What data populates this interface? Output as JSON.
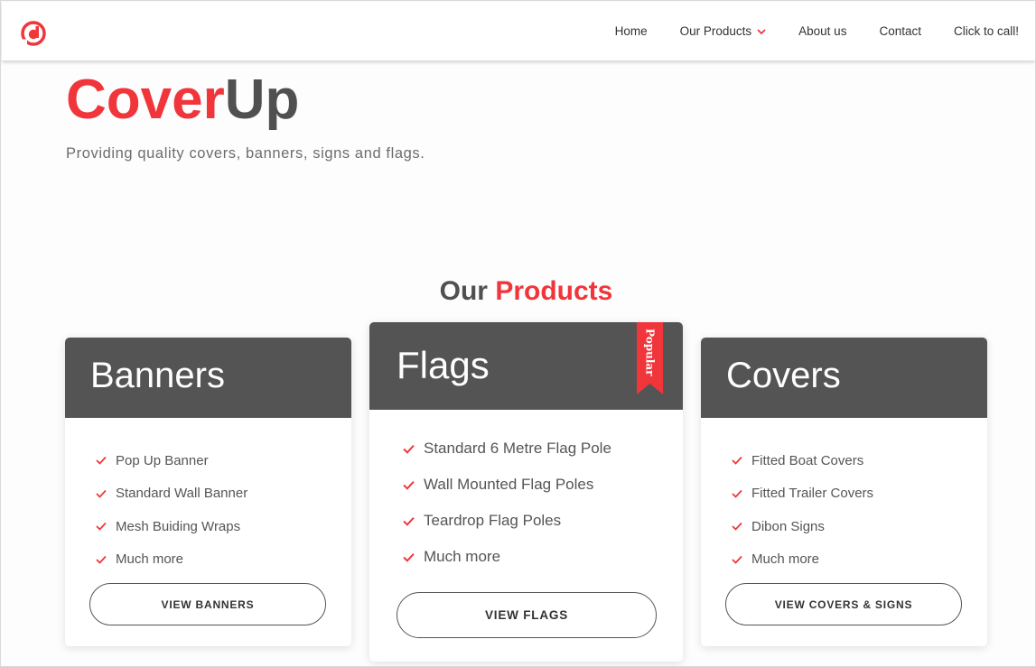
{
  "nav": {
    "links": [
      {
        "label": "Home"
      },
      {
        "label": "Our Products"
      },
      {
        "label": "About us"
      },
      {
        "label": "Contact"
      },
      {
        "label": "Click to call!"
      }
    ]
  },
  "hero": {
    "title_red": "Cover",
    "title_dark": "Up",
    "subtitle": "Providing quality covers, banners, signs and flags."
  },
  "section": {
    "title_dark": "Our ",
    "title_red": "Products"
  },
  "cards": {
    "banners": {
      "title": "Banners",
      "items": [
        "Pop Up Banner",
        "Standard Wall Banner",
        "Mesh Buiding Wraps",
        "Much more"
      ],
      "button": "VIEW BANNERS"
    },
    "flags": {
      "title": "Flags",
      "ribbon": "Popular",
      "items": [
        "Standard 6 Metre Flag Pole",
        "Wall Mounted Flag Poles",
        "Teardrop Flag Poles",
        "Much more"
      ],
      "button": "VIEW FLAGS"
    },
    "covers": {
      "title": "Covers",
      "items": [
        "Fitted Boat Covers",
        "Fitted Trailer Covers",
        "Dibon Signs",
        "Much more"
      ],
      "button": "VIEW COVERS & SIGNS"
    }
  },
  "icons": {
    "logo": "cd-logo-icon",
    "nav_chevron": "chevron-down-icon",
    "list_bullet": "check-icon"
  },
  "colors": {
    "accent": "#f0353b",
    "dark": "#505050",
    "card_head": "#545454"
  }
}
